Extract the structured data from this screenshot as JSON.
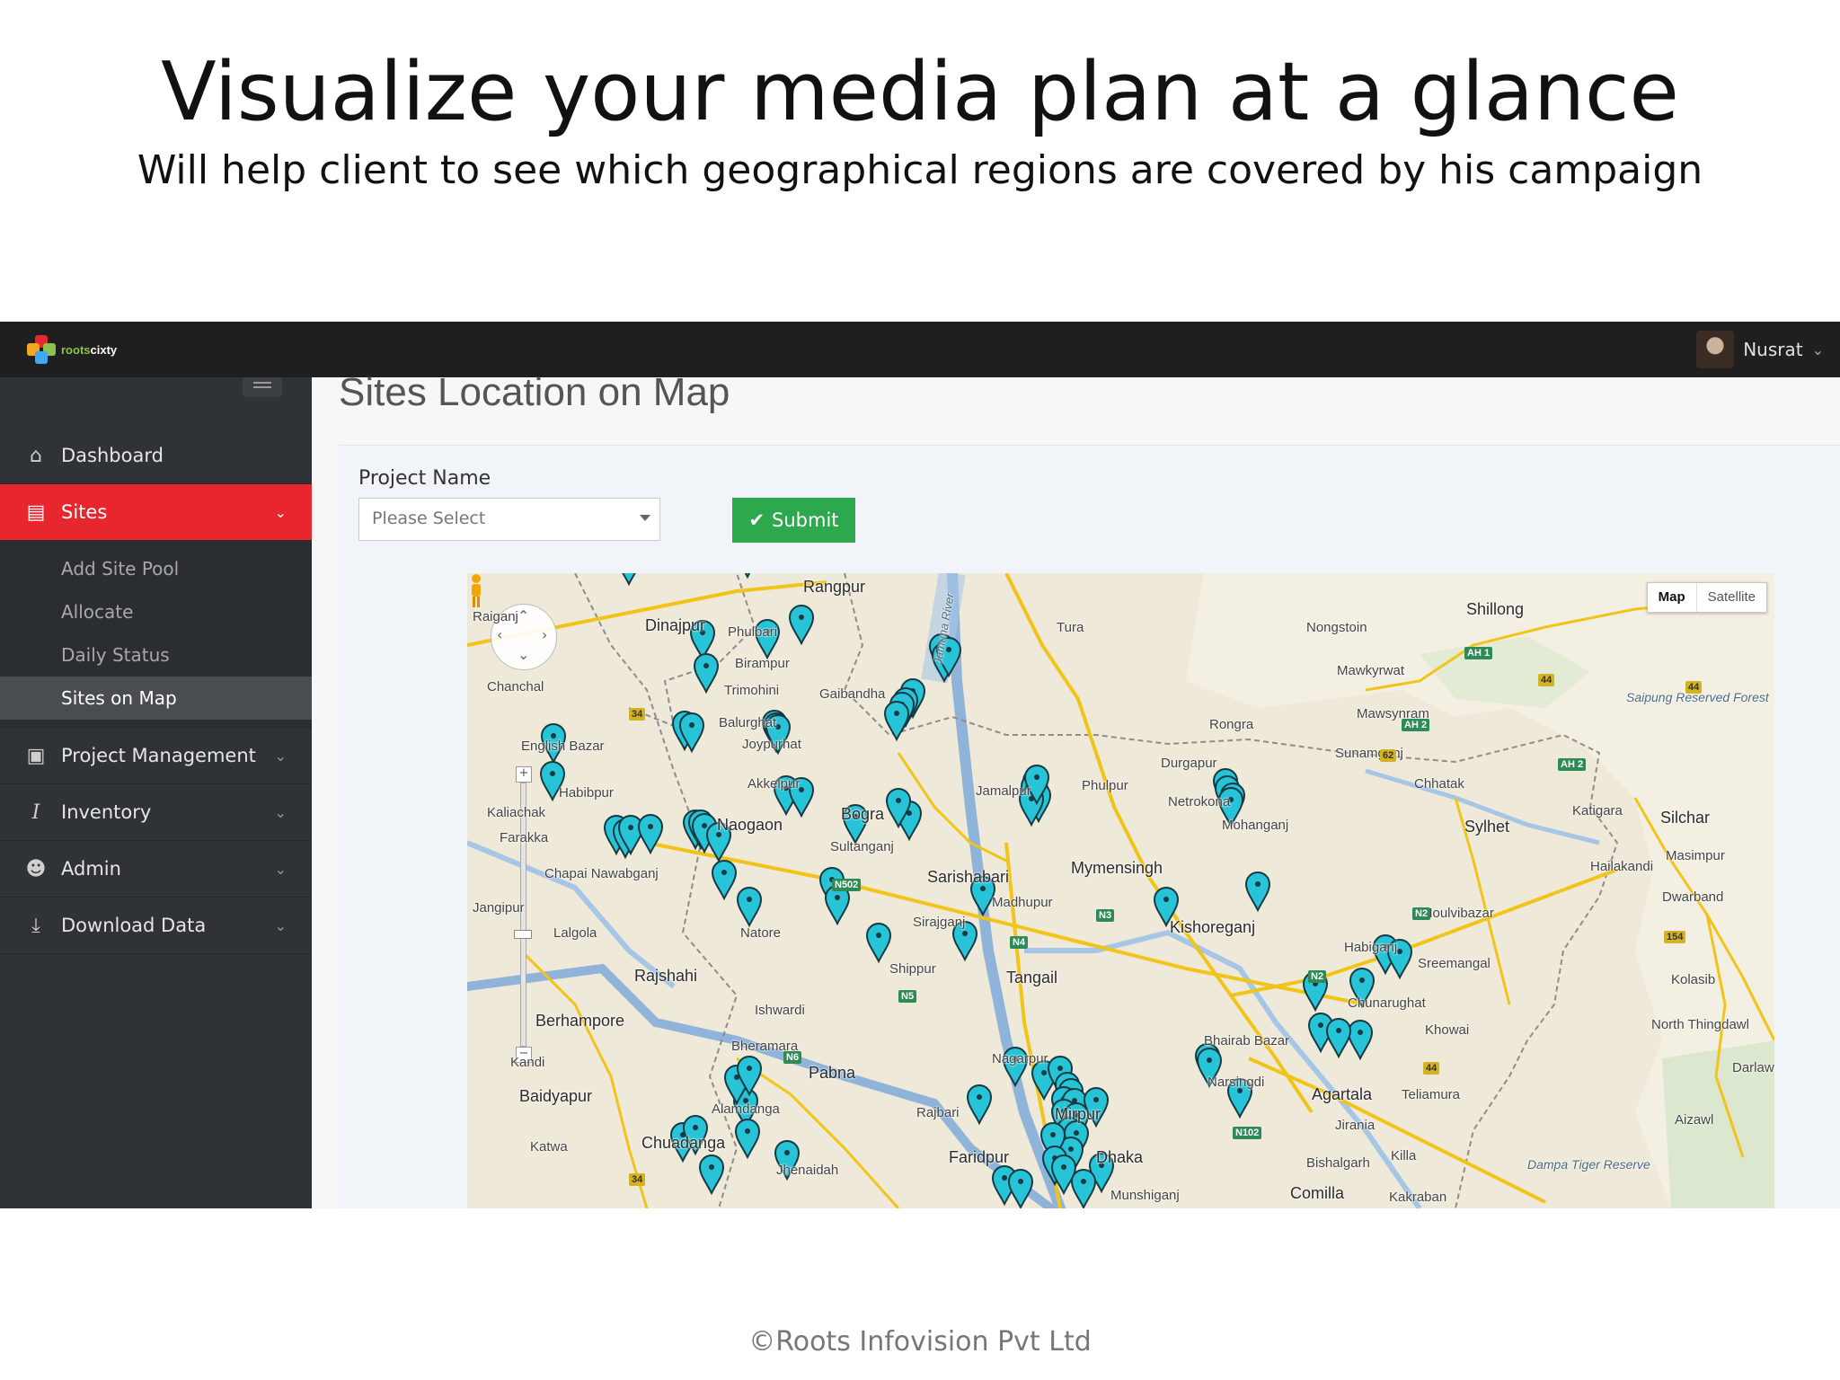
{
  "slide": {
    "title": "Visualize your media plan at a glance",
    "subtitle": "Will help client to see which geographical regions are covered by his campaign",
    "footer": "©Roots Infovision Pvt Ltd"
  },
  "topbar": {
    "logo_text_a": "roots",
    "logo_text_b": "cixty",
    "user_name": "Nusrat"
  },
  "sidebar": {
    "items": [
      {
        "label": "Dashboard",
        "icon": "home-icon"
      },
      {
        "label": "Sites",
        "icon": "file-icon",
        "active": true
      },
      {
        "label": "Project Management",
        "icon": "briefcase-icon"
      },
      {
        "label": "Inventory",
        "icon": "italic-i-icon"
      },
      {
        "label": "Admin",
        "icon": "user-icon"
      },
      {
        "label": "Download Data",
        "icon": "download-icon"
      }
    ],
    "sites_submenu": [
      "Add Site Pool",
      "Allocate",
      "Daily Status",
      "Sites on Map"
    ],
    "selected_submenu": "Sites on Map"
  },
  "page": {
    "title": "Sites Location on Map",
    "project_name_label": "Project Name",
    "project_select": {
      "value": "Please Select"
    },
    "submit_label": "Submit"
  },
  "map": {
    "type_buttons": [
      "Map",
      "Satellite"
    ],
    "selected_type": "Map",
    "marker_color": "#27c3d6",
    "labels": [
      {
        "text": "Rangpur"
      },
      {
        "text": "Dinajpur"
      },
      {
        "text": "Phulbari"
      },
      {
        "text": "Birampur"
      },
      {
        "text": "Gaibandha"
      },
      {
        "text": "Joypurhat"
      },
      {
        "text": "Akkelpur"
      },
      {
        "text": "Naogaon"
      },
      {
        "text": "Bogra"
      },
      {
        "text": "Sultanganj"
      },
      {
        "text": "Sarishabari"
      },
      {
        "text": "Jamalpur"
      },
      {
        "text": "Madhupur"
      },
      {
        "text": "Mymensingh"
      },
      {
        "text": "Phulpur"
      },
      {
        "text": "Netrokona"
      },
      {
        "text": "Durgapur"
      },
      {
        "text": "Mohanganj"
      },
      {
        "text": "Kishoreganj"
      },
      {
        "text": "Tangail"
      },
      {
        "text": "Shippur"
      },
      {
        "text": "Sirajganj"
      },
      {
        "text": "Rajshahi"
      },
      {
        "text": "Lalgola"
      },
      {
        "text": "Natore"
      },
      {
        "text": "Ishwardi"
      },
      {
        "text": "Pabna"
      },
      {
        "text": "Bheramara"
      },
      {
        "text": "Berhampore"
      },
      {
        "text": "Kandi"
      },
      {
        "text": "Baidyapur"
      },
      {
        "text": "Katwa"
      },
      {
        "text": "Chuadanga"
      },
      {
        "text": "Alamdanga"
      },
      {
        "text": "Jhenaidah"
      },
      {
        "text": "Rajbari"
      },
      {
        "text": "Faridpur"
      },
      {
        "text": "Nagarpur"
      },
      {
        "text": "Mirpur"
      },
      {
        "text": "Dhaka"
      },
      {
        "text": "Munshiganj"
      },
      {
        "text": "Narsingdi"
      },
      {
        "text": "Bhairab Bazar"
      },
      {
        "text": "Agartala"
      },
      {
        "text": "Teliamura"
      },
      {
        "text": "Jirania"
      },
      {
        "text": "Bishalgarh"
      },
      {
        "text": "Comilla"
      },
      {
        "text": "Kakraban"
      },
      {
        "text": "Killa"
      },
      {
        "text": "Shillong"
      },
      {
        "text": "Nongstoin"
      },
      {
        "text": "Mawkyrwat"
      },
      {
        "text": "Mawsynram"
      },
      {
        "text": "Sunamganj"
      },
      {
        "text": "Chhatak"
      },
      {
        "text": "Sylhet"
      },
      {
        "text": "Moulvibazar"
      },
      {
        "text": "Sreemangal"
      },
      {
        "text": "Habiganj"
      },
      {
        "text": "Chunarughat"
      },
      {
        "text": "Khowai"
      },
      {
        "text": "Katigara"
      },
      {
        "text": "Silchar"
      },
      {
        "text": "Hailakandi"
      },
      {
        "text": "Masimpur"
      },
      {
        "text": "Dwarband"
      },
      {
        "text": "Kolasib"
      },
      {
        "text": "North Thingdawl"
      },
      {
        "text": "Darlaw"
      },
      {
        "text": "Aizawl"
      },
      {
        "text": "Tura"
      },
      {
        "text": "Rongra"
      },
      {
        "text": "Saipung Reserved Forest"
      },
      {
        "text": "Dampa Tiger Reserve"
      },
      {
        "text": "Chanchal"
      },
      {
        "text": "English Bazar"
      },
      {
        "text": "Habibpur"
      },
      {
        "text": "Kaliachak"
      },
      {
        "text": "Farakka"
      },
      {
        "text": "Chapai Nawabganj"
      },
      {
        "text": "Jangipur"
      },
      {
        "text": "Raiganj"
      },
      {
        "text": "Balurghat"
      },
      {
        "text": "Trimohini"
      },
      {
        "text": "Jamuna River"
      }
    ]
  }
}
